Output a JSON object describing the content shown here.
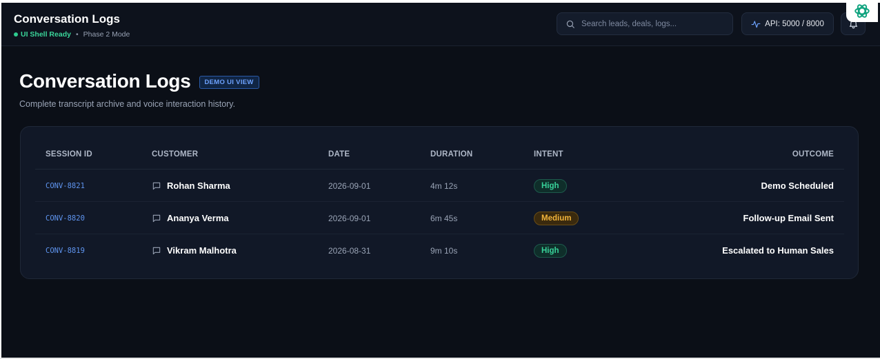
{
  "header": {
    "title": "Conversation Logs",
    "status_ready": "UI Shell Ready",
    "status_separator": "•",
    "status_mode": "Phase 2 Mode",
    "search_placeholder": "Search leads, deals, logs...",
    "api_label": "API: 5000 / 8000"
  },
  "page": {
    "title": "Conversation Logs",
    "badge": "DEMO UI VIEW",
    "subtitle": "Complete transcript archive and voice interaction history."
  },
  "table": {
    "columns": [
      "SESSION ID",
      "CUSTOMER",
      "DATE",
      "DURATION",
      "INTENT",
      "OUTCOME"
    ],
    "rows": [
      {
        "session_id": "CONV-8821",
        "customer": "Rohan Sharma",
        "date": "2026-09-01",
        "duration": "4m 12s",
        "intent": "High",
        "outcome": "Demo Scheduled"
      },
      {
        "session_id": "CONV-8820",
        "customer": "Ananya Verma",
        "date": "2026-09-01",
        "duration": "6m 45s",
        "intent": "Medium",
        "outcome": "Follow-up Email Sent"
      },
      {
        "session_id": "CONV-8819",
        "customer": "Vikram Malhotra",
        "date": "2026-08-31",
        "duration": "9m 10s",
        "intent": "High",
        "outcome": "Escalated to Human Sales"
      }
    ]
  },
  "icons": {
    "search": "search-icon",
    "api": "activity-icon",
    "bell": "bell-icon",
    "chat": "message-square-icon",
    "logo": "openai-logo-icon"
  },
  "colors": {
    "background": "#0b0f17",
    "accent_green": "#3ad59a",
    "session_blue": "#5f95f0",
    "intent_high": "#38d39a",
    "intent_medium": "#f2b43a"
  }
}
